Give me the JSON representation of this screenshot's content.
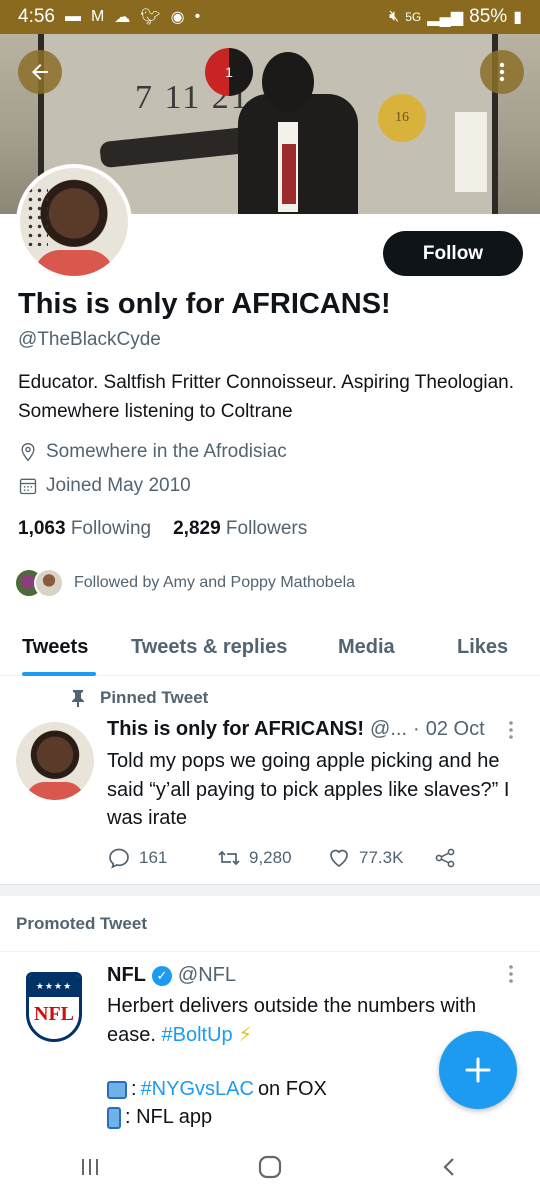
{
  "status_bar": {
    "time": "4:56",
    "signal": "5G",
    "battery": "85%"
  },
  "header": {
    "art_numbers": "7 11 21",
    "red_circle_label": "1",
    "gold_circle_label": "16"
  },
  "profile": {
    "follow_label": "Follow",
    "name": "This is only for AFRICANS!",
    "handle": "@TheBlackCyde",
    "bio": "Educator. Saltfish Fritter Connoisseur. Aspiring Theologian. Somewhere listening to Coltrane",
    "location": "Somewhere in the Afrodisiac",
    "joined": "Joined May 2010",
    "following_count": "1,063",
    "following_label": "Following",
    "followers_count": "2,829",
    "followers_label": "Followers",
    "followed_by": "Followed by Amy and Poppy Mathobela"
  },
  "tabs": [
    {
      "label": "Tweets",
      "active": true
    },
    {
      "label": "Tweets & replies",
      "active": false
    },
    {
      "label": "Media",
      "active": false
    },
    {
      "label": "Likes",
      "active": false
    }
  ],
  "pinned_tweet": {
    "pinned_label": "Pinned Tweet",
    "name": "This is only for AFRICANS!",
    "handle_trunc": "@...",
    "separator": "·",
    "date": "02 Oct",
    "text": "Told my pops we going apple picking and he said “y’all paying to pick apples like slaves?” I was irate",
    "replies": "161",
    "retweets": "9,280",
    "likes": "77.3K"
  },
  "promoted": {
    "label": "Promoted Tweet",
    "logo_text": "NFL",
    "name": "NFL",
    "handle": "@NFL",
    "text_before": "Herbert delivers outside the numbers with ease. ",
    "hashtag1": "#BoltUp",
    "bolt": "⚡",
    "line1_hashtag": "#NYGvsLAC",
    "line1_text": " on FOX",
    "line2_text": ": NFL app",
    "colon": ":"
  },
  "fab_label": "+",
  "icons": {
    "back": "back-arrow-icon",
    "more": "more-vertical-icon",
    "location": "location-pin-icon",
    "calendar": "calendar-icon",
    "pin": "pin-icon",
    "reply": "reply-icon",
    "retweet": "retweet-icon",
    "like": "heart-icon",
    "share": "share-icon",
    "verified": "verified-badge-icon",
    "compose": "compose-plus-icon"
  },
  "colors": {
    "accent": "#1d9bf0",
    "status_bar": "#8a6a1f",
    "text_primary": "#0f1419",
    "text_secondary": "#536471"
  }
}
